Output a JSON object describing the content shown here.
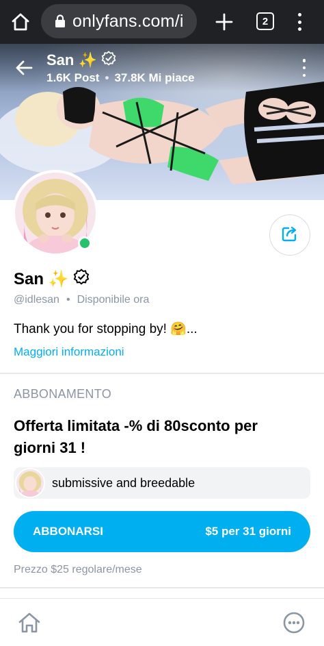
{
  "browser": {
    "url": "onlyfans.com/i",
    "tab_count": "2"
  },
  "cover": {
    "title": "San ✨",
    "posts": "1.6K Post",
    "separator": "•",
    "likes": "37.8K Mi piace"
  },
  "profile": {
    "name": "San ✨",
    "handle": "@idlesan",
    "separator": "•",
    "availability": "Disponibile ora",
    "bio": "Thank you for stopping by! 🤗...",
    "more_link": "Maggiori informazioni",
    "online": true
  },
  "subscription": {
    "section_title": "ABBONAMENTO",
    "offer": "Offerta limitata -% di 80sconto per giorni 31 !",
    "message": "submissive and breedable",
    "button_label": "ABBONARSI",
    "button_price": "$5 per 31 giorni",
    "regular_price": "Prezzo $25 regolare/mese"
  },
  "colors": {
    "accent": "#00aff0",
    "online": "#23c26b",
    "muted_text": "#8a96a3",
    "chrome_bg": "#202124"
  },
  "icons": [
    "home-icon",
    "lock-icon",
    "plus-icon",
    "tab-switcher-icon",
    "browser-menu-icon",
    "back-arrow-icon",
    "verified-icon",
    "more-vertical-icon",
    "share-icon",
    "nav-home-icon",
    "more-options-icon"
  ]
}
